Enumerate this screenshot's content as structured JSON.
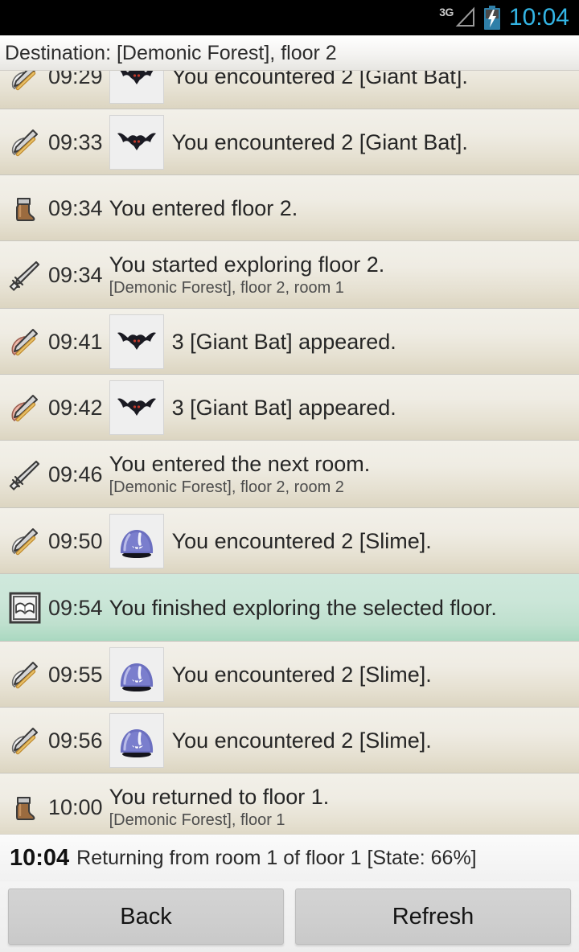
{
  "statusbar": {
    "network_label": "3G",
    "network_icon": "signal-triangle-icon",
    "battery_icon": "battery-charging-icon",
    "time": "10:04",
    "time_color": "#33b5e5"
  },
  "header": {
    "destination_text": "Destination: [Demonic Forest], floor 2"
  },
  "log": {
    "highlight_color": "#bfe0ce",
    "entries": [
      {
        "icon": "sword-white-feather-icon",
        "time": "09:29",
        "thumb": "giant-bat-thumb",
        "message": "You encountered 2 [Giant Bat].",
        "sub": "",
        "highlighted": false
      },
      {
        "icon": "sword-white-feather-icon",
        "time": "09:33",
        "thumb": "giant-bat-thumb",
        "message": "You encountered 2 [Giant Bat].",
        "sub": "",
        "highlighted": false
      },
      {
        "icon": "boot-icon",
        "time": "09:34",
        "thumb": "",
        "message": "You entered floor 2.",
        "sub": "",
        "highlighted": false
      },
      {
        "icon": "sword-icon",
        "time": "09:34",
        "thumb": "",
        "message": "You started exploring floor 2.",
        "sub": "[Demonic Forest], floor 2, room 1",
        "highlighted": false
      },
      {
        "icon": "sword-red-feather-icon",
        "time": "09:41",
        "thumb": "giant-bat-thumb",
        "message": "3 [Giant Bat] appeared.",
        "sub": "",
        "highlighted": false
      },
      {
        "icon": "sword-red-feather-icon",
        "time": "09:42",
        "thumb": "giant-bat-thumb",
        "message": "3 [Giant Bat] appeared.",
        "sub": "",
        "highlighted": false
      },
      {
        "icon": "sword-icon",
        "time": "09:46",
        "thumb": "",
        "message": "You entered the next room.",
        "sub": "[Demonic Forest], floor 2, room 2",
        "highlighted": false
      },
      {
        "icon": "sword-white-feather-icon",
        "time": "09:50",
        "thumb": "slime-thumb",
        "message": "You encountered 2 [Slime].",
        "sub": "",
        "highlighted": false
      },
      {
        "icon": "book-icon",
        "time": "09:54",
        "thumb": "",
        "message": "You finished exploring the selected floor.",
        "sub": "",
        "highlighted": true
      },
      {
        "icon": "sword-white-feather-icon",
        "time": "09:55",
        "thumb": "slime-thumb",
        "message": "You encountered 2 [Slime].",
        "sub": "",
        "highlighted": false
      },
      {
        "icon": "sword-white-feather-icon",
        "time": "09:56",
        "thumb": "slime-thumb",
        "message": "You encountered 2 [Slime].",
        "sub": "",
        "highlighted": false
      },
      {
        "icon": "boot-icon",
        "time": "10:00",
        "thumb": "",
        "message": "You returned to floor 1.",
        "sub": "[Demonic Forest], floor 1",
        "highlighted": false
      }
    ]
  },
  "footer": {
    "status_time": "10:04",
    "status_text": "Returning from room 1 of floor 1 [State: 66%]",
    "back_label": "Back",
    "refresh_label": "Refresh"
  }
}
